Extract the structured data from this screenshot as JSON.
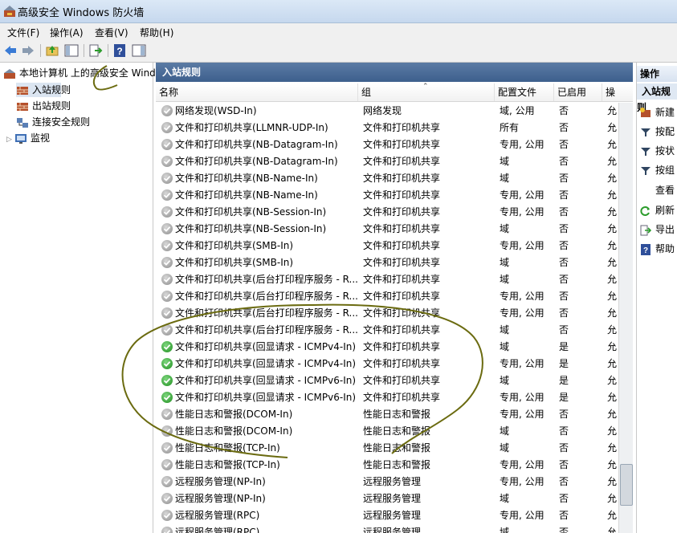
{
  "window": {
    "title": "高级安全 Windows 防火墙"
  },
  "menu": [
    "文件(F)",
    "操作(A)",
    "查看(V)",
    "帮助(H)"
  ],
  "tree": {
    "root": "本地计算机 上的高级安全 Windows 防火墙",
    "items": [
      "入站规则",
      "出站规则",
      "连接安全规则",
      "监视"
    ]
  },
  "middle": {
    "header": "入站规则",
    "columns": [
      "名称",
      "组",
      "配置文件",
      "已启用",
      "操"
    ],
    "rows": [
      {
        "name": "网络发现(WSD-In)",
        "group": "网络发现",
        "profile": "域, 公用",
        "enabled": "否",
        "action": "允",
        "on": false
      },
      {
        "name": "文件和打印机共享(LLMNR-UDP-In)",
        "group": "文件和打印机共享",
        "profile": "所有",
        "enabled": "否",
        "action": "允",
        "on": false
      },
      {
        "name": "文件和打印机共享(NB-Datagram-In)",
        "group": "文件和打印机共享",
        "profile": "专用, 公用",
        "enabled": "否",
        "action": "允",
        "on": false
      },
      {
        "name": "文件和打印机共享(NB-Datagram-In)",
        "group": "文件和打印机共享",
        "profile": "域",
        "enabled": "否",
        "action": "允",
        "on": false
      },
      {
        "name": "文件和打印机共享(NB-Name-In)",
        "group": "文件和打印机共享",
        "profile": "域",
        "enabled": "否",
        "action": "允",
        "on": false
      },
      {
        "name": "文件和打印机共享(NB-Name-In)",
        "group": "文件和打印机共享",
        "profile": "专用, 公用",
        "enabled": "否",
        "action": "允",
        "on": false
      },
      {
        "name": "文件和打印机共享(NB-Session-In)",
        "group": "文件和打印机共享",
        "profile": "专用, 公用",
        "enabled": "否",
        "action": "允",
        "on": false
      },
      {
        "name": "文件和打印机共享(NB-Session-In)",
        "group": "文件和打印机共享",
        "profile": "域",
        "enabled": "否",
        "action": "允",
        "on": false
      },
      {
        "name": "文件和打印机共享(SMB-In)",
        "group": "文件和打印机共享",
        "profile": "专用, 公用",
        "enabled": "否",
        "action": "允",
        "on": false
      },
      {
        "name": "文件和打印机共享(SMB-In)",
        "group": "文件和打印机共享",
        "profile": "域",
        "enabled": "否",
        "action": "允",
        "on": false
      },
      {
        "name": "文件和打印机共享(后台打印程序服务 - R...",
        "group": "文件和打印机共享",
        "profile": "域",
        "enabled": "否",
        "action": "允",
        "on": false
      },
      {
        "name": "文件和打印机共享(后台打印程序服务 - R...",
        "group": "文件和打印机共享",
        "profile": "专用, 公用",
        "enabled": "否",
        "action": "允",
        "on": false
      },
      {
        "name": "文件和打印机共享(后台打印程序服务 - R...",
        "group": "文件和打印机共享",
        "profile": "专用, 公用",
        "enabled": "否",
        "action": "允",
        "on": false
      },
      {
        "name": "文件和打印机共享(后台打印程序服务 - R...",
        "group": "文件和打印机共享",
        "profile": "域",
        "enabled": "否",
        "action": "允",
        "on": false
      },
      {
        "name": "文件和打印机共享(回显请求 - ICMPv4-In)",
        "group": "文件和打印机共享",
        "profile": "域",
        "enabled": "是",
        "action": "允",
        "on": true
      },
      {
        "name": "文件和打印机共享(回显请求 - ICMPv4-In)",
        "group": "文件和打印机共享",
        "profile": "专用, 公用",
        "enabled": "是",
        "action": "允",
        "on": true
      },
      {
        "name": "文件和打印机共享(回显请求 - ICMPv6-In)",
        "group": "文件和打印机共享",
        "profile": "域",
        "enabled": "是",
        "action": "允",
        "on": true
      },
      {
        "name": "文件和打印机共享(回显请求 - ICMPv6-In)",
        "group": "文件和打印机共享",
        "profile": "专用, 公用",
        "enabled": "是",
        "action": "允",
        "on": true
      },
      {
        "name": "性能日志和警报(DCOM-In)",
        "group": "性能日志和警报",
        "profile": "专用, 公用",
        "enabled": "否",
        "action": "允",
        "on": false
      },
      {
        "name": "性能日志和警报(DCOM-In)",
        "group": "性能日志和警报",
        "profile": "域",
        "enabled": "否",
        "action": "允",
        "on": false
      },
      {
        "name": "性能日志和警报(TCP-In)",
        "group": "性能日志和警报",
        "profile": "域",
        "enabled": "否",
        "action": "允",
        "on": false
      },
      {
        "name": "性能日志和警报(TCP-In)",
        "group": "性能日志和警报",
        "profile": "专用, 公用",
        "enabled": "否",
        "action": "允",
        "on": false
      },
      {
        "name": "远程服务管理(NP-In)",
        "group": "远程服务管理",
        "profile": "专用, 公用",
        "enabled": "否",
        "action": "允",
        "on": false
      },
      {
        "name": "远程服务管理(NP-In)",
        "group": "远程服务管理",
        "profile": "域",
        "enabled": "否",
        "action": "允",
        "on": false
      },
      {
        "name": "远程服务管理(RPC)",
        "group": "远程服务管理",
        "profile": "专用, 公用",
        "enabled": "否",
        "action": "允",
        "on": false
      },
      {
        "name": "远程服务管理(RPC)",
        "group": "远程服务管理",
        "profile": "域",
        "enabled": "否",
        "action": "允",
        "on": false
      }
    ]
  },
  "actions": {
    "header": "操作",
    "section": "入站规则",
    "items": [
      {
        "label": "新建",
        "icon": "new-rule-icon"
      },
      {
        "label": "按配",
        "icon": "filter-icon"
      },
      {
        "label": "按状",
        "icon": "filter-icon"
      },
      {
        "label": "按组",
        "icon": "filter-icon"
      },
      {
        "label": "查看",
        "icon": "none"
      },
      {
        "label": "刷新",
        "icon": "refresh-icon"
      },
      {
        "label": "导出",
        "icon": "export-icon"
      },
      {
        "label": "帮助",
        "icon": "help-icon"
      }
    ]
  },
  "colors": {
    "header_blue": "#4a6d9a",
    "enabled_green": "#1f8f1f",
    "annotation": "#6b6b10"
  }
}
